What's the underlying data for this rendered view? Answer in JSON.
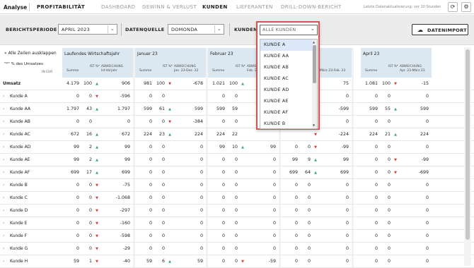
{
  "topbar": {
    "brand": "Analyse",
    "module": "PROFITABILITÄT",
    "tabs": [
      "DASHBOARD",
      "GEWINN & VERLUST",
      "KUNDEN",
      "LIEFERANTEN",
      "DRILL-DOWN-BERICHT"
    ],
    "active_tab": "KUNDEN",
    "update_text": "Letzte Datenaktualisierung: vor 10 Stunden",
    "refresh_icon": "refresh-icon",
    "settings_icon": "gear-icon"
  },
  "filters": {
    "period_label": "BERICHTSPERIODE",
    "period_value": "APRIL 2023",
    "source_label": "DATENQUELLE",
    "source_value": "DOMONDA",
    "customer_label": "KUNDEN",
    "customer_value": "ALLE KUNDEN",
    "import_label": "DATENIMPORT",
    "import_icon": "cloud-upload-icon"
  },
  "dropdown": {
    "options": [
      "KUNDE A",
      "KUNDE AA",
      "KUNDE AB",
      "KUNDE AC",
      "KUNDE AD",
      "KUNDE AE",
      "KUNDE AF",
      "KUNDE B"
    ],
    "highlighted": "KUNDE A"
  },
  "grid": {
    "expand_label": "Alle Zeilen ausklappen",
    "percent_label": "\"*\" % des Umsatzes",
    "unit_label": "IN EUR",
    "col_groups": [
      {
        "title": "Laufendes Wirtschaftsjahr",
        "summe": "Summe",
        "ist": "IST %*",
        "abw": "ABWEICHUNG",
        "abw_sub": "Ist-Vorjahr"
      },
      {
        "title": "Januar 23",
        "summe": "Summe",
        "ist": "IST %*",
        "abw": "ABWEICHUNG",
        "abw_sub": "Jan. 23-Dez. 22"
      },
      {
        "title": "Februar 23",
        "summe": "Summe",
        "ist": "IST %*",
        "abw": "ABWEICHUNG",
        "abw_sub": "Feb. 23-Jan. 23"
      },
      {
        "title": "",
        "summe": "",
        "ist": "",
        "abw": "",
        "abw_sub": "März 23-Feb. 23"
      },
      {
        "title": "April 23",
        "summe": "Summe",
        "ist": "IST %*",
        "abw": "ABWEICHUNG",
        "abw_sub": "Apr. 23-März 23"
      }
    ],
    "rows": [
      {
        "label": "Umsatz",
        "top": true,
        "g1": [
          "4.179",
          "100",
          "▲",
          "906"
        ],
        "g2": [
          "981",
          "100",
          "▼",
          "-678"
        ],
        "g3": [
          "1.021",
          "100",
          "▲",
          ""
        ],
        "g4": [
          "",
          "",
          "▲",
          "75"
        ],
        "g5": [
          "1.081",
          "100",
          "▼",
          "-15"
        ]
      },
      {
        "label": "Kunde A",
        "g1": [
          "0",
          "0",
          "▼",
          "-596"
        ],
        "g2": [
          "0",
          "0",
          "",
          ""
        ],
        "g3": [
          "0",
          "0",
          "",
          ""
        ],
        "g4": [
          "",
          "",
          "",
          "0"
        ],
        "g5": [
          "0",
          "0",
          "",
          "0"
        ]
      },
      {
        "label": "Kunde AA",
        "g1": [
          "1.797",
          "43",
          "▲",
          "1.797"
        ],
        "g2": [
          "599",
          "61",
          "▲",
          "599"
        ],
        "g3": [
          "599",
          "59",
          "",
          ""
        ],
        "g4": [
          "",
          "",
          "▼",
          "-599"
        ],
        "g5": [
          "599",
          "55",
          "▲",
          "599"
        ]
      },
      {
        "label": "Kunde AB",
        "g1": [
          "0",
          "0",
          "",
          "0"
        ],
        "g2": [
          "0",
          "0",
          "▼",
          "-384"
        ],
        "g3": [
          "0",
          "0",
          "",
          ""
        ],
        "g4": [
          "",
          "",
          "",
          "0"
        ],
        "g5": [
          "0",
          "0",
          "",
          "0"
        ]
      },
      {
        "label": "Kunde AC",
        "g1": [
          "672",
          "16",
          "▲",
          "672"
        ],
        "g2": [
          "224",
          "23",
          "▲",
          "224"
        ],
        "g3": [
          "224",
          "22",
          "",
          ""
        ],
        "g4": [
          "",
          "",
          "▼",
          "-224"
        ],
        "g5": [
          "224",
          "21",
          "▲",
          "224"
        ]
      },
      {
        "label": "Kunde AD",
        "g1": [
          "99",
          "2",
          "▲",
          "99"
        ],
        "g2": [
          "0",
          "0",
          "",
          "0"
        ],
        "g3": [
          "99",
          "10",
          "▲",
          "99"
        ],
        "g4": [
          "0",
          "0",
          "▼",
          "-99"
        ],
        "g5": [
          "0",
          "0",
          "",
          "0"
        ]
      },
      {
        "label": "Kunde AE",
        "g1": [
          "99",
          "2",
          "▲",
          "99"
        ],
        "g2": [
          "0",
          "0",
          "",
          "0"
        ],
        "g3": [
          "0",
          "0",
          "",
          "0"
        ],
        "g4": [
          "99",
          "9",
          "▲",
          "99"
        ],
        "g5": [
          "0",
          "0",
          "▼",
          "-99"
        ]
      },
      {
        "label": "Kunde AF",
        "g1": [
          "699",
          "17",
          "▲",
          "699"
        ],
        "g2": [
          "0",
          "0",
          "",
          "0"
        ],
        "g3": [
          "0",
          "0",
          "",
          "0"
        ],
        "g4": [
          "699",
          "64",
          "▲",
          "699"
        ],
        "g5": [
          "0",
          "0",
          "▼",
          "-699"
        ]
      },
      {
        "label": "Kunde B",
        "g1": [
          "0",
          "0",
          "▼",
          "-75"
        ],
        "g2": [
          "0",
          "0",
          "",
          "0"
        ],
        "g3": [
          "0",
          "0",
          "",
          "0"
        ],
        "g4": [
          "0",
          "0",
          "",
          "0"
        ],
        "g5": [
          "0",
          "0",
          "",
          "0"
        ]
      },
      {
        "label": "Kunde C",
        "g1": [
          "0",
          "0",
          "▼",
          "-1.068"
        ],
        "g2": [
          "0",
          "0",
          "",
          "0"
        ],
        "g3": [
          "0",
          "0",
          "",
          "0"
        ],
        "g4": [
          "0",
          "0",
          "",
          "0"
        ],
        "g5": [
          "0",
          "0",
          "",
          "0"
        ]
      },
      {
        "label": "Kunde D",
        "g1": [
          "0",
          "0",
          "▼",
          "-297"
        ],
        "g2": [
          "0",
          "0",
          "",
          "0"
        ],
        "g3": [
          "0",
          "0",
          "",
          "0"
        ],
        "g4": [
          "0",
          "0",
          "",
          "0"
        ],
        "g5": [
          "0",
          "0",
          "",
          "0"
        ]
      },
      {
        "label": "Kunde E",
        "g1": [
          "0",
          "0",
          "▼",
          "-160"
        ],
        "g2": [
          "0",
          "0",
          "",
          "0"
        ],
        "g3": [
          "0",
          "0",
          "",
          "0"
        ],
        "g4": [
          "0",
          "0",
          "",
          "0"
        ],
        "g5": [
          "0",
          "0",
          "",
          "0"
        ]
      },
      {
        "label": "Kunde F",
        "g1": [
          "0",
          "0",
          "▼",
          "-598"
        ],
        "g2": [
          "0",
          "0",
          "",
          "0"
        ],
        "g3": [
          "0",
          "0",
          "",
          "0"
        ],
        "g4": [
          "0",
          "0",
          "",
          "0"
        ],
        "g5": [
          "0",
          "0",
          "",
          "0"
        ]
      },
      {
        "label": "Kunde G",
        "g1": [
          "0",
          "0",
          "▼",
          "-29"
        ],
        "g2": [
          "0",
          "0",
          "",
          "0"
        ],
        "g3": [
          "0",
          "0",
          "",
          "0"
        ],
        "g4": [
          "0",
          "0",
          "",
          "0"
        ],
        "g5": [
          "0",
          "0",
          "",
          "0"
        ]
      },
      {
        "label": "Kunde H",
        "g1": [
          "59",
          "1",
          "▼",
          "-40"
        ],
        "g2": [
          "59",
          "6",
          "▲",
          "59"
        ],
        "g3": [
          "0",
          "0",
          "▼",
          "-59"
        ],
        "g4": [
          "0",
          "0",
          "",
          "0"
        ],
        "g5": [
          "0",
          "0",
          "",
          "0"
        ]
      }
    ]
  }
}
